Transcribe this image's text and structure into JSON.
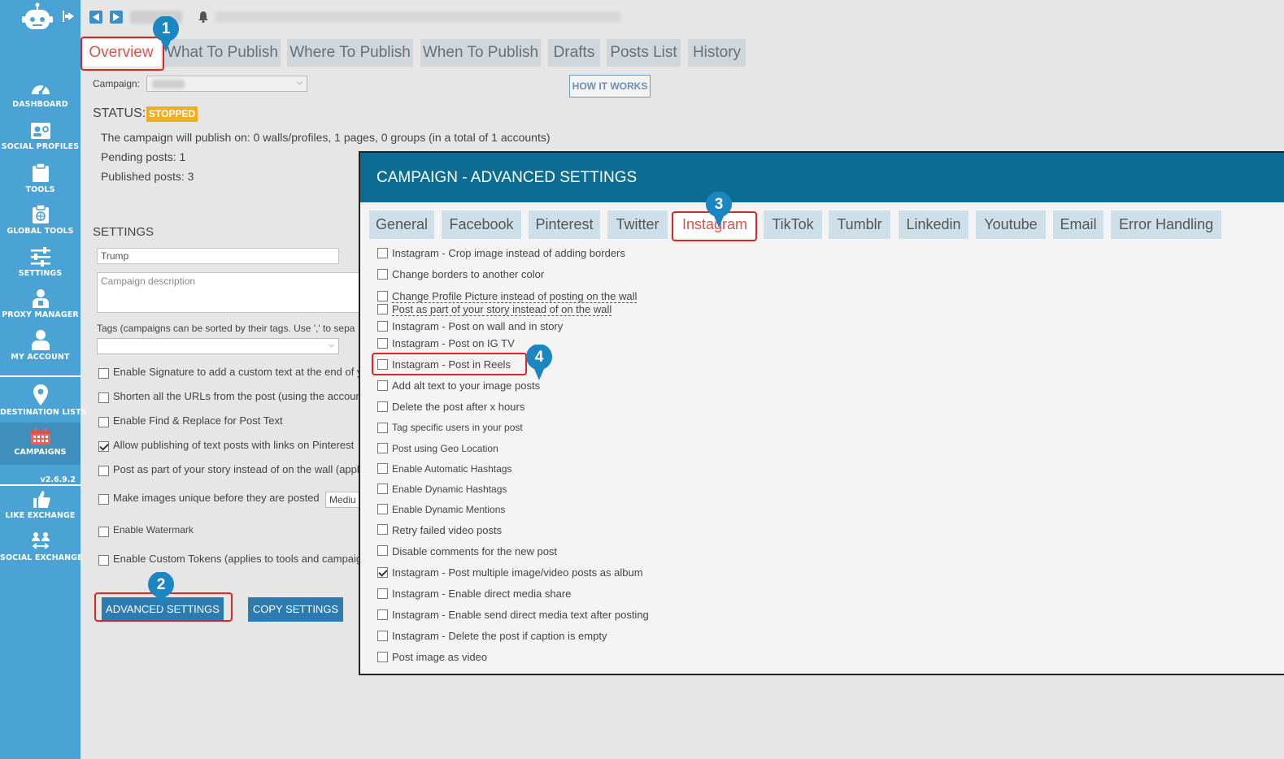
{
  "sidebar": {
    "items": [
      {
        "label": "DASHBOARD",
        "icon": "dashboard-gauge-icon"
      },
      {
        "label": "SOCIAL PROFILES",
        "icon": "social-profiles-icon"
      },
      {
        "label": "TOOLS",
        "icon": "clipboard-icon"
      },
      {
        "label": "GLOBAL TOOLS",
        "icon": "globe-clipboard-icon"
      },
      {
        "label": "SETTINGS",
        "icon": "sliders-icon"
      },
      {
        "label": "PROXY MANAGER",
        "icon": "proxy-user-icon"
      },
      {
        "label": "MY ACCOUNT",
        "icon": "user-icon"
      },
      {
        "label": "DESTINATION LISTS",
        "icon": "map-pin-icon"
      },
      {
        "label": "CAMPAIGNS",
        "icon": "calendar-icon"
      },
      {
        "label": "LIKE EXCHANGE",
        "icon": "thumbs-up-icon"
      },
      {
        "label": "SOCIAL EXCHANGE",
        "icon": "people-exchange-icon"
      }
    ],
    "version": "v2.6.9.2"
  },
  "tabs": [
    "Overview",
    "What To Publish",
    "Where To Publish",
    "When To Publish",
    "Drafts",
    "Posts List",
    "History"
  ],
  "campaign_label": "Campaign:",
  "how_it_works": "HOW IT WORKS",
  "status": {
    "label": "STATUS:",
    "value": "STOPPED"
  },
  "info": {
    "publish_on": "The campaign will publish on: 0 walls/profiles, 1 pages, 0 groups (in a total of 1 accounts)",
    "pending": "Pending posts: 1",
    "published": "Published posts: 3"
  },
  "settings": {
    "heading": "SETTINGS",
    "name_value": "Trump",
    "description_placeholder": "Campaign description",
    "tags_label": "Tags (campaigns can be sorted by their tags. Use ',' to sepa",
    "options": [
      {
        "label": "Enable Signature to add a custom text at the end of y",
        "checked": false
      },
      {
        "label": "Shorten all the URLs from the post (using the account",
        "checked": false
      },
      {
        "label": "Enable Find & Replace for Post Text",
        "checked": false
      },
      {
        "label": "Allow publishing of text posts with links on Pinterest",
        "checked": true
      },
      {
        "label": "Post as part of your story instead of on the wall (appli",
        "checked": false
      },
      {
        "label": "Make images unique before they are posted",
        "checked": false
      },
      {
        "label": "Enable Watermark",
        "checked": false
      },
      {
        "label": "Enable Custom Tokens (applies to tools and campaign",
        "checked": false
      }
    ],
    "unique_select": "Mediu",
    "advanced_button": "ADVANCED SETTINGS",
    "copy_button": "COPY SETTINGS"
  },
  "modal": {
    "title": "CAMPAIGN - ADVANCED SETTINGS",
    "tabs": [
      "General",
      "Facebook",
      "Pinterest",
      "Twitter",
      "Instagram",
      "TikTok",
      "Tumblr",
      "Linkedin",
      "Youtube",
      "Email",
      "Error Handling"
    ],
    "options": [
      {
        "label": "Instagram - Crop image instead of adding borders",
        "checked": false
      },
      {
        "label": "Change borders to another color",
        "checked": false
      },
      {
        "label": "Change Profile Picture instead of posting on the wall",
        "checked": false
      },
      {
        "label": "Post as part of your story instead of on the wall",
        "checked": false
      },
      {
        "label": "Instagram - Post on wall and in story",
        "checked": false
      },
      {
        "label": "Instagram - Post on IG TV",
        "checked": false
      },
      {
        "label": "Instagram - Post in Reels",
        "checked": false
      },
      {
        "label": "Add alt text to your image posts",
        "checked": false
      },
      {
        "label": "Delete the post after x hours",
        "checked": false
      },
      {
        "label": "Tag specific users in your post",
        "checked": false
      },
      {
        "label": "Post using Geo Location",
        "checked": false
      },
      {
        "label": "Enable Automatic Hashtags",
        "checked": false
      },
      {
        "label": "Enable Dynamic Hashtags",
        "checked": false
      },
      {
        "label": "Enable Dynamic Mentions",
        "checked": false
      },
      {
        "label": "Retry failed video posts",
        "checked": false
      },
      {
        "label": "Disable comments for the new post",
        "checked": false
      },
      {
        "label": "Instagram - Post multiple image/video posts as album",
        "checked": true
      },
      {
        "label": "Instagram - Enable direct media share",
        "checked": false
      },
      {
        "label": "Instagram - Enable send direct media text after posting",
        "checked": false
      },
      {
        "label": "Instagram - Delete the post if caption is empty",
        "checked": false
      },
      {
        "label": "Post image as video",
        "checked": false
      }
    ]
  },
  "markers": [
    "1",
    "2",
    "3",
    "4"
  ],
  "colors": {
    "sidebar": "#4aa3d4",
    "modal_header": "#0c6c91",
    "highlight": "#e02424",
    "status": "#f0ad1e",
    "active_tab_text": "#d9534f"
  }
}
